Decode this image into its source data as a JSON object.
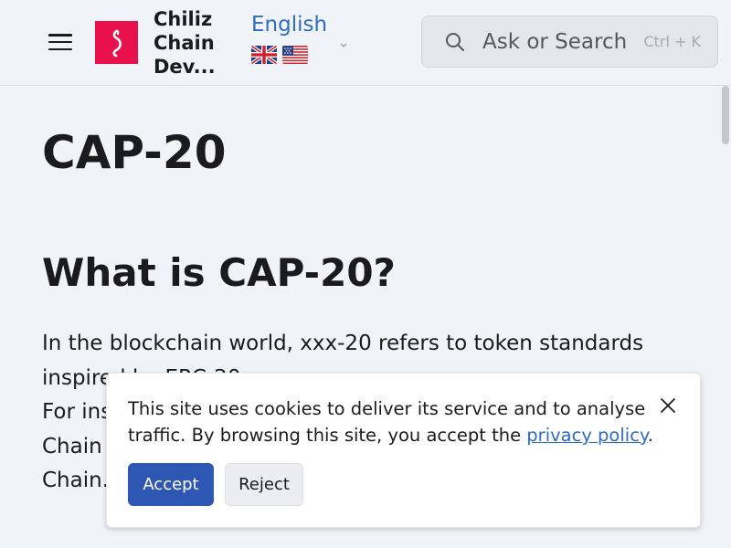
{
  "header": {
    "site_title_lines": [
      "Chiliz",
      "Chain",
      "Dev..."
    ],
    "language": {
      "label": "English",
      "flags": [
        "uk-flag",
        "us-flag"
      ]
    },
    "search": {
      "placeholder": "Ask or Search",
      "shortcut": "Ctrl + K"
    },
    "icons": {
      "menu": "hamburger-menu-icon",
      "logo": "chiliz-logo-icon",
      "search": "search-icon",
      "chevron": "chevron-down-icon"
    }
  },
  "main": {
    "title": "CAP-20",
    "section_heading": "What is CAP-20?",
    "paragraph_lines": [
      "In the blockchain world, xxx-20 refers to token standards",
      "inspired by ERC-20.",
      "For ins",
      "Chain",
      "Chain."
    ]
  },
  "cookie_banner": {
    "text_before": "This site uses cookies to deliver its service and to analyse traffic. By browsing this site, you accept the ",
    "link_text": "privacy policy",
    "text_after": ".",
    "accept_label": "Accept",
    "reject_label": "Reject",
    "close_icon": "close-icon"
  },
  "colors": {
    "background": "#f0f3f7",
    "brand": "#e8114b",
    "link": "#2e6bc6",
    "accept_button": "#2d57b3"
  }
}
